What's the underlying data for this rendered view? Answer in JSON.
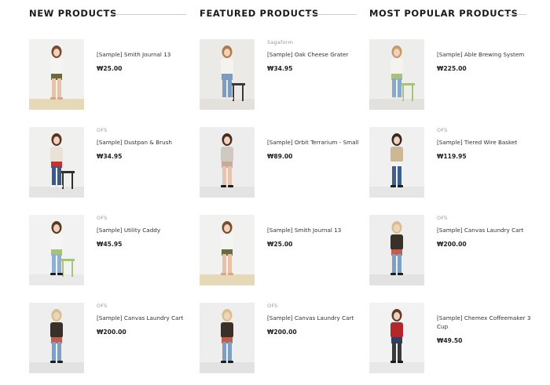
{
  "columns": [
    {
      "title": "NEW PRODUCTS",
      "items": [
        {
          "brand": "",
          "name": "[Sample] Smith Journal 13",
          "price": "₩25.00",
          "image": "girl-tank-top-plaid",
          "bg": "#f1f1ef",
          "floor": "#e6d9b8"
        },
        {
          "brand": "OFS",
          "name": "[Sample] Dustpan & Brush",
          "price": "₩34.95",
          "image": "girl-sitting-stool-red",
          "bg": "#f0f0ef",
          "floor": "#e4e4e4"
        },
        {
          "brand": "OFS",
          "name": "[Sample] Utility Caddy",
          "price": "₩45.95",
          "image": "girl-jeans-green-chair",
          "bg": "#f2f2f2",
          "floor": "#e9e9e9"
        },
        {
          "brand": "OFS",
          "name": "[Sample] Canvas Laundry Cart",
          "price": "₩200.00",
          "image": "girl-tshirt-jeans-squat",
          "bg": "#eeeeee",
          "floor": "#e2e2e2"
        }
      ]
    },
    {
      "title": "FEATURED PRODUCTS",
      "items": [
        {
          "brand": "Sagaform",
          "name": "[Sample] Oak Cheese Grater",
          "price": "₩34.95",
          "image": "girl-white-sweater-stool",
          "bg": "#eceae7",
          "floor": "#e4e1dc"
        },
        {
          "brand": "",
          "name": "[Sample] Orbit Terrarium - Small",
          "price": "₩89.00",
          "image": "girl-pleated-skirt",
          "bg": "#ededed",
          "floor": "#e3e3e3"
        },
        {
          "brand": "",
          "name": "[Sample] Smith Journal 13",
          "price": "₩25.00",
          "image": "girl-tank-top-plaid",
          "bg": "#f1f1ef",
          "floor": "#e6d9b8"
        },
        {
          "brand": "OFS",
          "name": "[Sample] Canvas Laundry Cart",
          "price": "₩200.00",
          "image": "girl-tshirt-jeans-squat",
          "bg": "#eeeeee",
          "floor": "#e2e2e2"
        }
      ]
    },
    {
      "title": "MOST POPULAR PRODUCTS",
      "items": [
        {
          "brand": "",
          "name": "[Sample] Able Brewing System",
          "price": "₩225.00",
          "image": "girl-green-chair-sweater",
          "bg": "#ededeb",
          "floor": "#e1e1de"
        },
        {
          "brand": "OFS",
          "name": "[Sample] Tiered Wire Basket",
          "price": "₩119.95",
          "image": "girl-beige-parka",
          "bg": "#f0f0f0",
          "floor": "#e6e6e6"
        },
        {
          "brand": "OFS",
          "name": "[Sample] Canvas Laundry Cart",
          "price": "₩200.00",
          "image": "girl-tshirt-jeans-squat",
          "bg": "#eeeeee",
          "floor": "#e2e2e2"
        },
        {
          "brand": "",
          "name": "[Sample] Chemex Coffeemaker 3 Cup",
          "price": "₩49.50",
          "image": "girl-red-sweater-skirt",
          "bg": "#f2f2f2",
          "floor": "#e8e8e8"
        }
      ]
    }
  ]
}
